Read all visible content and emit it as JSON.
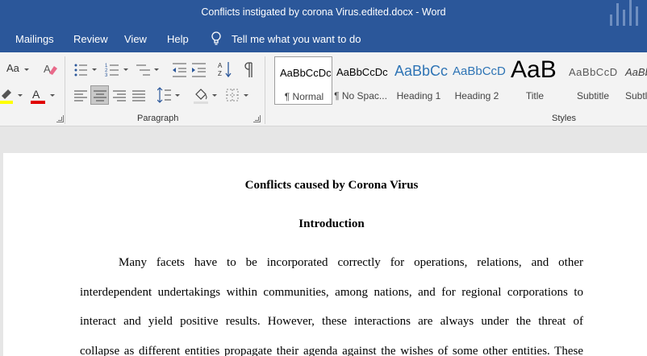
{
  "window": {
    "title": "Conflicts instigated by corona Virus.edited.docx  -  Word"
  },
  "menu": {
    "items": [
      "Mailings",
      "Review",
      "View",
      "Help"
    ],
    "tell_me": "Tell me what you want to do"
  },
  "ribbon": {
    "font_group": {
      "change_case_label": "Aa"
    },
    "paragraph_group": {
      "label": "Paragraph"
    },
    "styles_group": {
      "label": "Styles",
      "styles": [
        {
          "sample": "AaBbCcDc",
          "name": "¶ Normal"
        },
        {
          "sample": "AaBbCcDc",
          "name": "¶ No Spac..."
        },
        {
          "sample": "AaBbCc",
          "name": "Heading 1"
        },
        {
          "sample": "AaBbCcD",
          "name": "Heading 2"
        },
        {
          "sample": "AaB",
          "name": "Title"
        },
        {
          "sample": "AaBbCcD",
          "name": "Subtitle"
        },
        {
          "sample": "AaBb",
          "name": "Subtl"
        }
      ]
    },
    "colors": {
      "accent": "#2b579a",
      "highlight": "#ffff00",
      "font_color": "#e00000"
    }
  },
  "document": {
    "title": "Conflicts caused by Corona Virus",
    "heading": "Introduction",
    "lines": [
      "Many facets have to be incorporated correctly for operations, relations, and other",
      "interdependent undertakings within communities, among nations, and for regional corporations to",
      "interact and yield positive results. However, these interactions are always under the threat of",
      "collapse as different entities propagate their agenda against the wishes of some other entities. These"
    ]
  }
}
